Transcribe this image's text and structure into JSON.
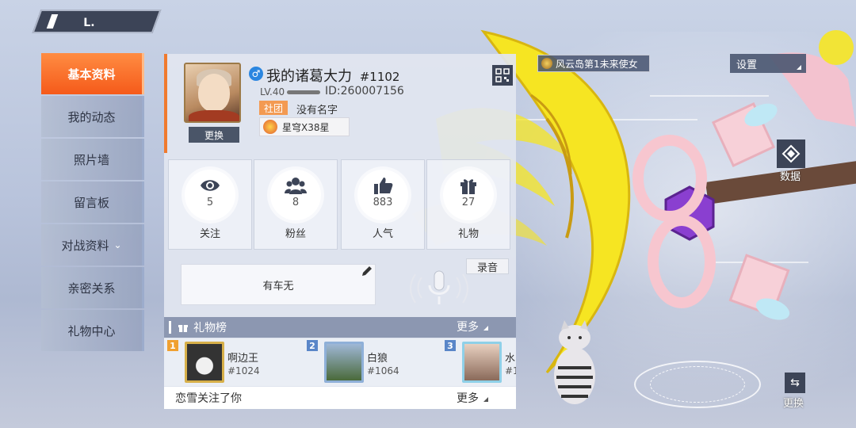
{
  "nav": {
    "back_mark": "L."
  },
  "sidebar": {
    "items": [
      {
        "label": "基本资料",
        "active": true
      },
      {
        "label": "我的动态"
      },
      {
        "label": "照片墙"
      },
      {
        "label": "留言板"
      },
      {
        "label": "对战资料",
        "has_chevron": true
      },
      {
        "label": "亲密关系"
      },
      {
        "label": "礼物中心"
      }
    ]
  },
  "profile": {
    "change_avatar_label": "更换",
    "gender_symbol": "♂",
    "nickname": "我的诸葛大力",
    "tag": "#1102",
    "level": "LV.40",
    "uid": "ID:260007156",
    "club_tag": "社团",
    "club_name": "没有名字",
    "rank_text": "星穹X38星"
  },
  "stats": [
    {
      "icon": "eye-icon",
      "value": "5",
      "label": "关注"
    },
    {
      "icon": "followers-icon",
      "value": "8",
      "label": "粉丝"
    },
    {
      "icon": "thumbs-up-icon",
      "value": "883",
      "label": "人气"
    },
    {
      "icon": "gift-icon",
      "value": "27",
      "label": "礼物"
    }
  ],
  "signature": {
    "text": "有车无",
    "record_label": "录音"
  },
  "gift_rank": {
    "title": "礼物榜",
    "more_label": "更多",
    "entries": [
      {
        "rank": "1",
        "name": "啊边王",
        "id": "#1024",
        "rank_color": "#f0a030"
      },
      {
        "rank": "2",
        "name": "白狼",
        "id": "#1064",
        "rank_color": "#5a86c8"
      },
      {
        "rank": "3",
        "name": "水",
        "id": "#1",
        "rank_color": "#5a86c8"
      }
    ]
  },
  "follow_notice": {
    "text": "恋雪关注了你",
    "more_label": "更多"
  },
  "right": {
    "title_badge": "风云岛第1未来使女",
    "settings_label": "设置",
    "data_label": "数据",
    "swap_label": "更换"
  },
  "colors": {
    "accent": "#f55a1a",
    "dark_button": "#3c4457",
    "weapon_yellow": "#f6e522"
  }
}
